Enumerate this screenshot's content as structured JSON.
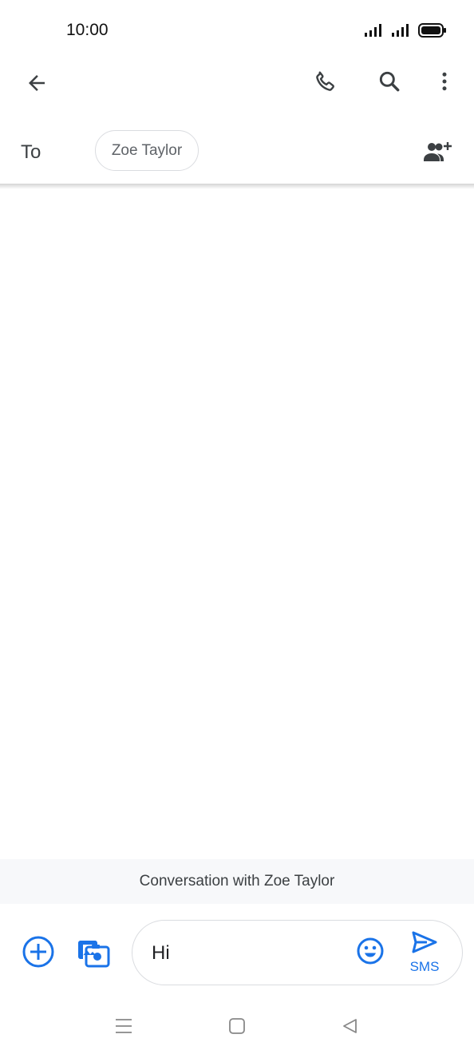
{
  "status_bar": {
    "time": "10:00"
  },
  "app_bar": {
    "back_icon": "arrow-back-icon",
    "call_icon": "phone-icon",
    "search_icon": "search-icon",
    "more_icon": "more-vert-icon"
  },
  "recipients": {
    "to_label": "To",
    "chips": [
      "Zoe Taylor"
    ],
    "add_icon": "add-people-icon"
  },
  "banner": {
    "text": "Conversation with Zoe Taylor"
  },
  "compose": {
    "text": "Hi",
    "send_label": "SMS",
    "attach_icon": "add-circle-icon",
    "gallery_icon": "photo-camera-icon",
    "emoji_icon": "emoji-icon",
    "send_icon": "send-icon"
  },
  "colors": {
    "accent": "#1a73e8",
    "icon_gray": "#3c4043",
    "banner_bg": "#f7f8fa",
    "border": "#dadce0"
  },
  "nav": {
    "menu_icon": "menu-icon",
    "home_icon": "home-square-icon",
    "back_icon": "back-triangle-icon"
  }
}
